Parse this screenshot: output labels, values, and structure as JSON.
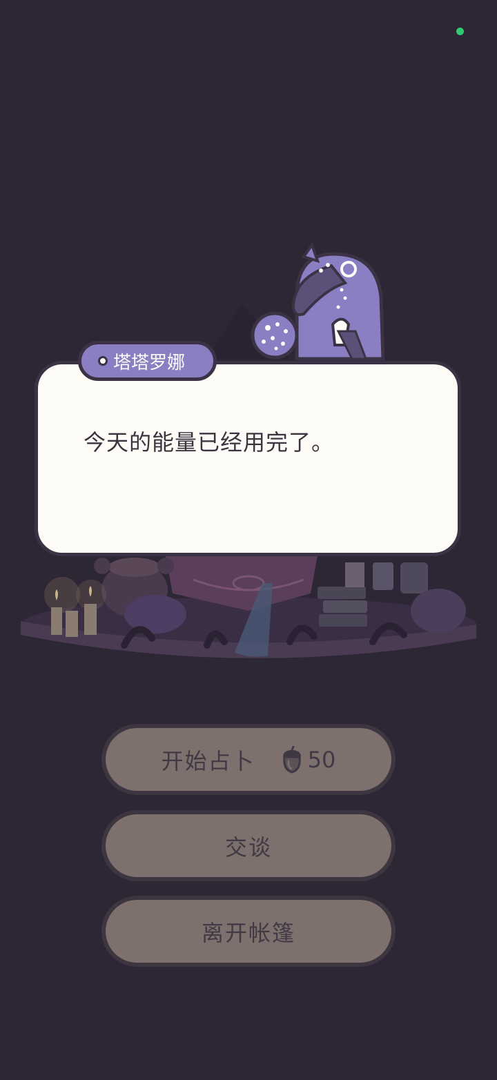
{
  "status": {
    "indicator_color": "#2ecc71"
  },
  "npc": {
    "name": "塔塔罗娜",
    "message": "今天的能量已经用完了。"
  },
  "menu": {
    "fortune": {
      "label": "开始占卜",
      "cost": "50",
      "cost_icon": "acorn-icon"
    },
    "talk": {
      "label": "交谈"
    },
    "leave": {
      "label": "离开帐篷"
    }
  },
  "colors": {
    "background": "#2d2635",
    "dialog_fill": "#fdfbf5",
    "name_tag": "#8a7fc3",
    "button_fill": "#7d706d"
  }
}
